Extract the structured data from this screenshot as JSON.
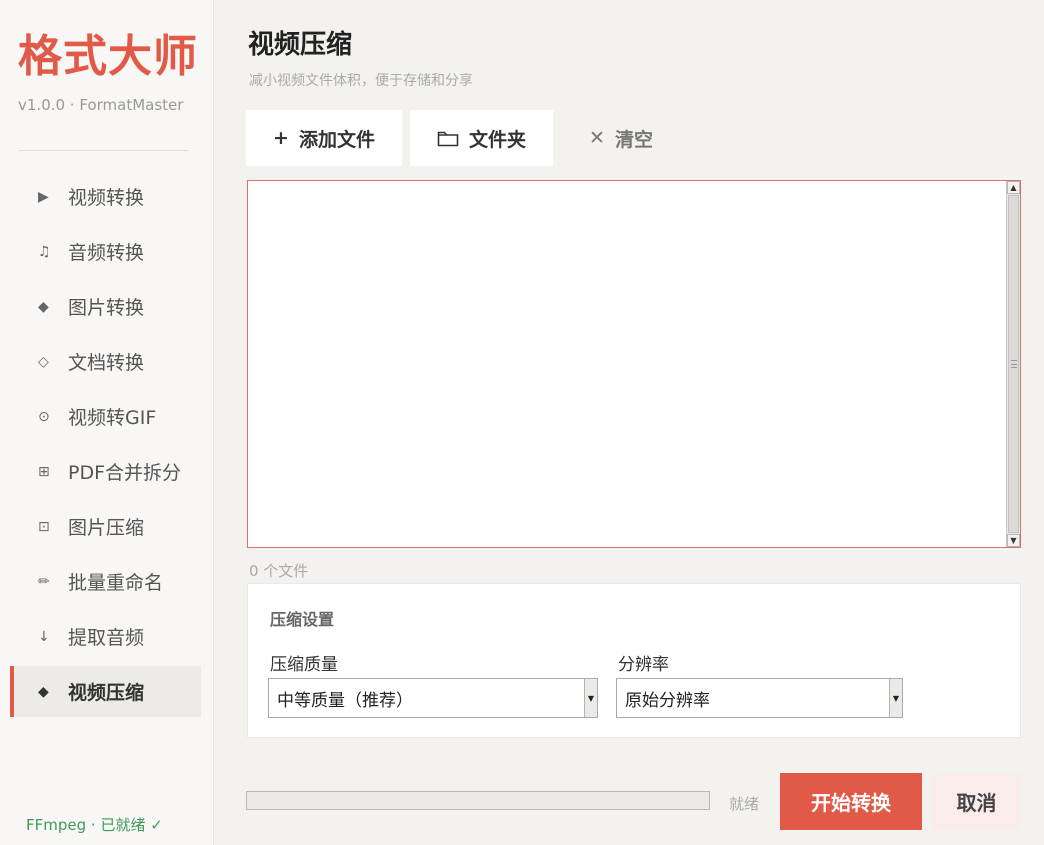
{
  "app": {
    "brand": "格式大师",
    "version": "v1.0.0 · FormatMaster",
    "ffmpeg_status": "FFmpeg · 已就绪 ✓"
  },
  "sidebar": {
    "items": [
      {
        "icon": "▶",
        "label": "视频转换",
        "active": false
      },
      {
        "icon": "♫",
        "label": "音频转换",
        "active": false
      },
      {
        "icon": "◆",
        "label": "图片转换",
        "active": false
      },
      {
        "icon": "◇",
        "label": "文档转换",
        "active": false
      },
      {
        "icon": "⊙",
        "label": "视频转GIF",
        "active": false
      },
      {
        "icon": "⊞",
        "label": "PDF合并拆分",
        "active": false
      },
      {
        "icon": "⊡",
        "label": "图片压缩",
        "active": false
      },
      {
        "icon": "✏",
        "label": "批量重命名",
        "active": false
      },
      {
        "icon": "↓",
        "label": "提取音频",
        "active": false
      },
      {
        "icon": "◆",
        "label": "视频压缩",
        "active": true
      }
    ]
  },
  "page": {
    "title": "视频压缩",
    "subtitle": "减小视频文件体积，便于存储和分享"
  },
  "toolbar": {
    "add_files": {
      "icon": "+",
      "label": "添加文件"
    },
    "folder": {
      "icon": "folder-icon",
      "label": "文件夹"
    },
    "clear": {
      "icon": "✕",
      "label": "清空"
    }
  },
  "filelist": {
    "count_text": "0 个文件"
  },
  "settings": {
    "title": "压缩设置",
    "quality": {
      "label": "压缩质量",
      "value": "中等质量（推荐）"
    },
    "resolution": {
      "label": "分辨率",
      "value": "原始分辨率"
    }
  },
  "footer": {
    "progress": 0,
    "status": "就绪",
    "start_label": "开始转换",
    "cancel_label": "取消"
  },
  "colors": {
    "accent": "#e05a47",
    "success": "#3f9a5b"
  }
}
